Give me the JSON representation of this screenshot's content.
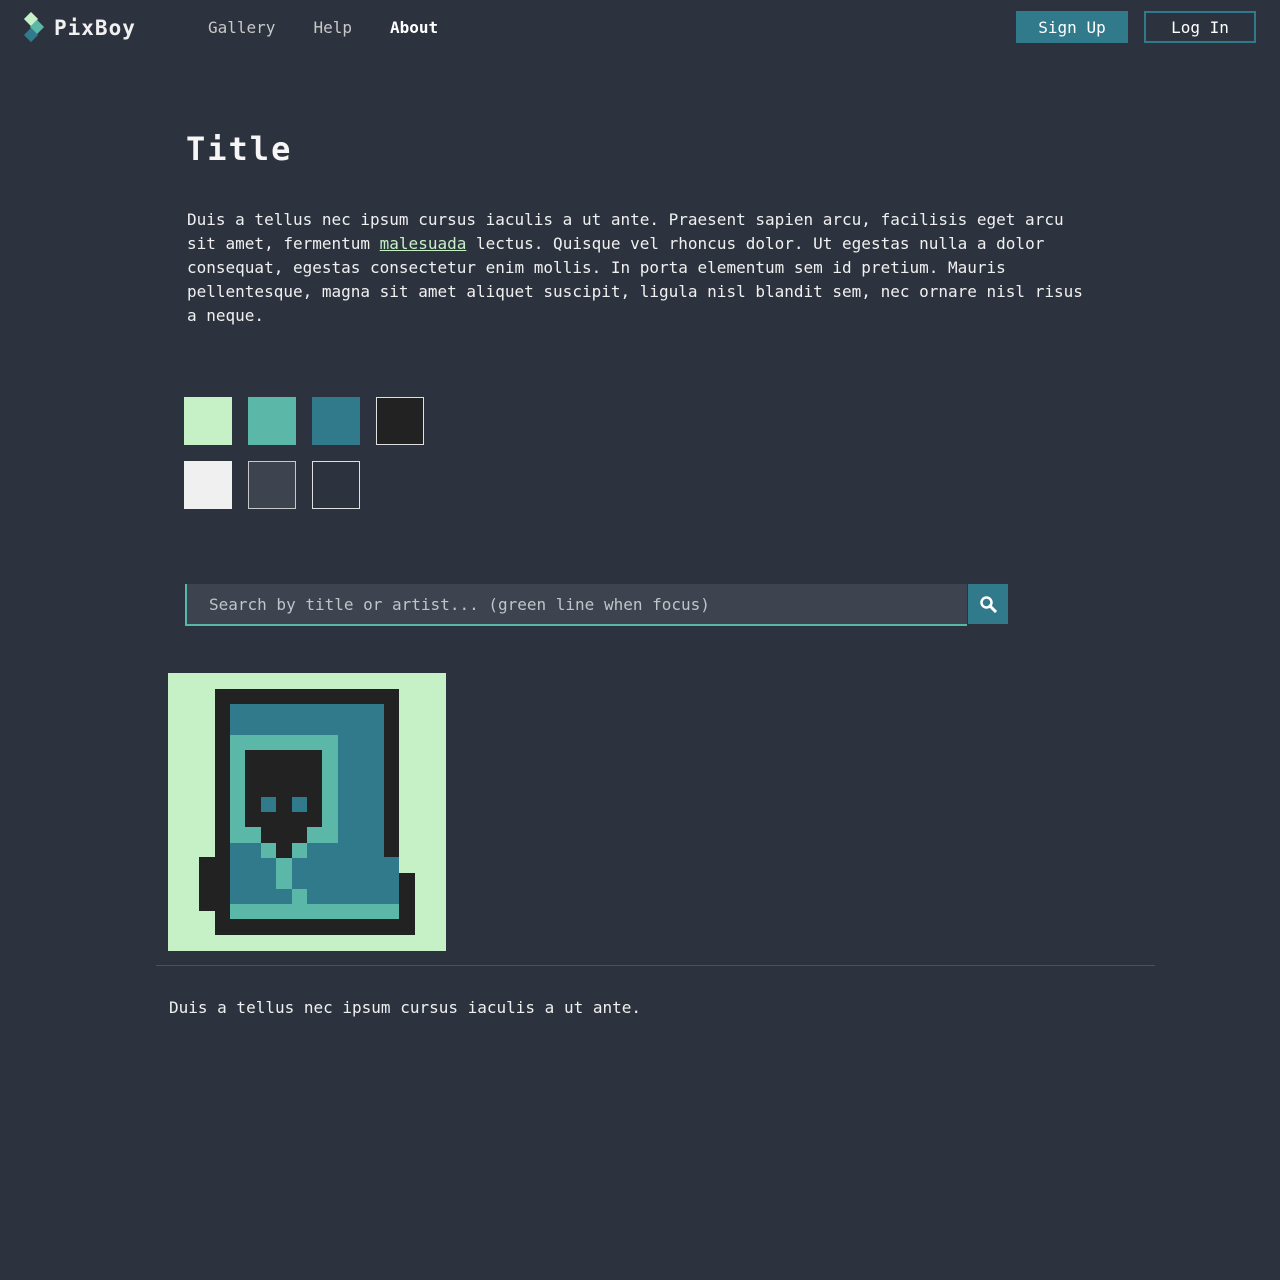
{
  "brand": {
    "name": "PixBoy",
    "icon": "diamond-logo-icon"
  },
  "nav": {
    "items": [
      {
        "label": "Gallery",
        "active": false
      },
      {
        "label": "Help",
        "active": false
      },
      {
        "label": "About",
        "active": true
      }
    ]
  },
  "auth": {
    "signup_label": "Sign Up",
    "login_label": "Log In"
  },
  "content": {
    "title": "Title",
    "paragraph_before_link": "Duis a tellus nec ipsum cursus iaculis a ut ante. Praesent sapien arcu, facilisis eget arcu sit amet, fermentum ",
    "link_text": "malesuada",
    "paragraph_after_link": " lectus. Quisque vel rhoncus dolor. Ut egestas nulla a dolor consequat, egestas consectetur enim mollis. In porta elementum sem id pretium. Mauris pellentesque, magna sit amet aliquet suscipit, ligula nisl blandit sem, nec ornare nisl risus a neque."
  },
  "palette": {
    "swatches": [
      "#c6f1c6",
      "#5bb8a8",
      "#317a8c",
      "#222222",
      "#f0f0f0",
      "#3d444f",
      "#2d333e"
    ]
  },
  "search": {
    "placeholder": "Search by title or artist... (green line when focus)",
    "icon": "search-icon"
  },
  "artwork": {
    "icon": "pixel-character-art"
  },
  "footer": {
    "text": "Duis a tellus nec ipsum cursus iaculis a ut ante."
  },
  "colors": {
    "background": "#2d333e",
    "accent": "#317a8c",
    "accent_light": "#5bb8a8",
    "mint": "#c6f1c6",
    "dark": "#222222"
  }
}
